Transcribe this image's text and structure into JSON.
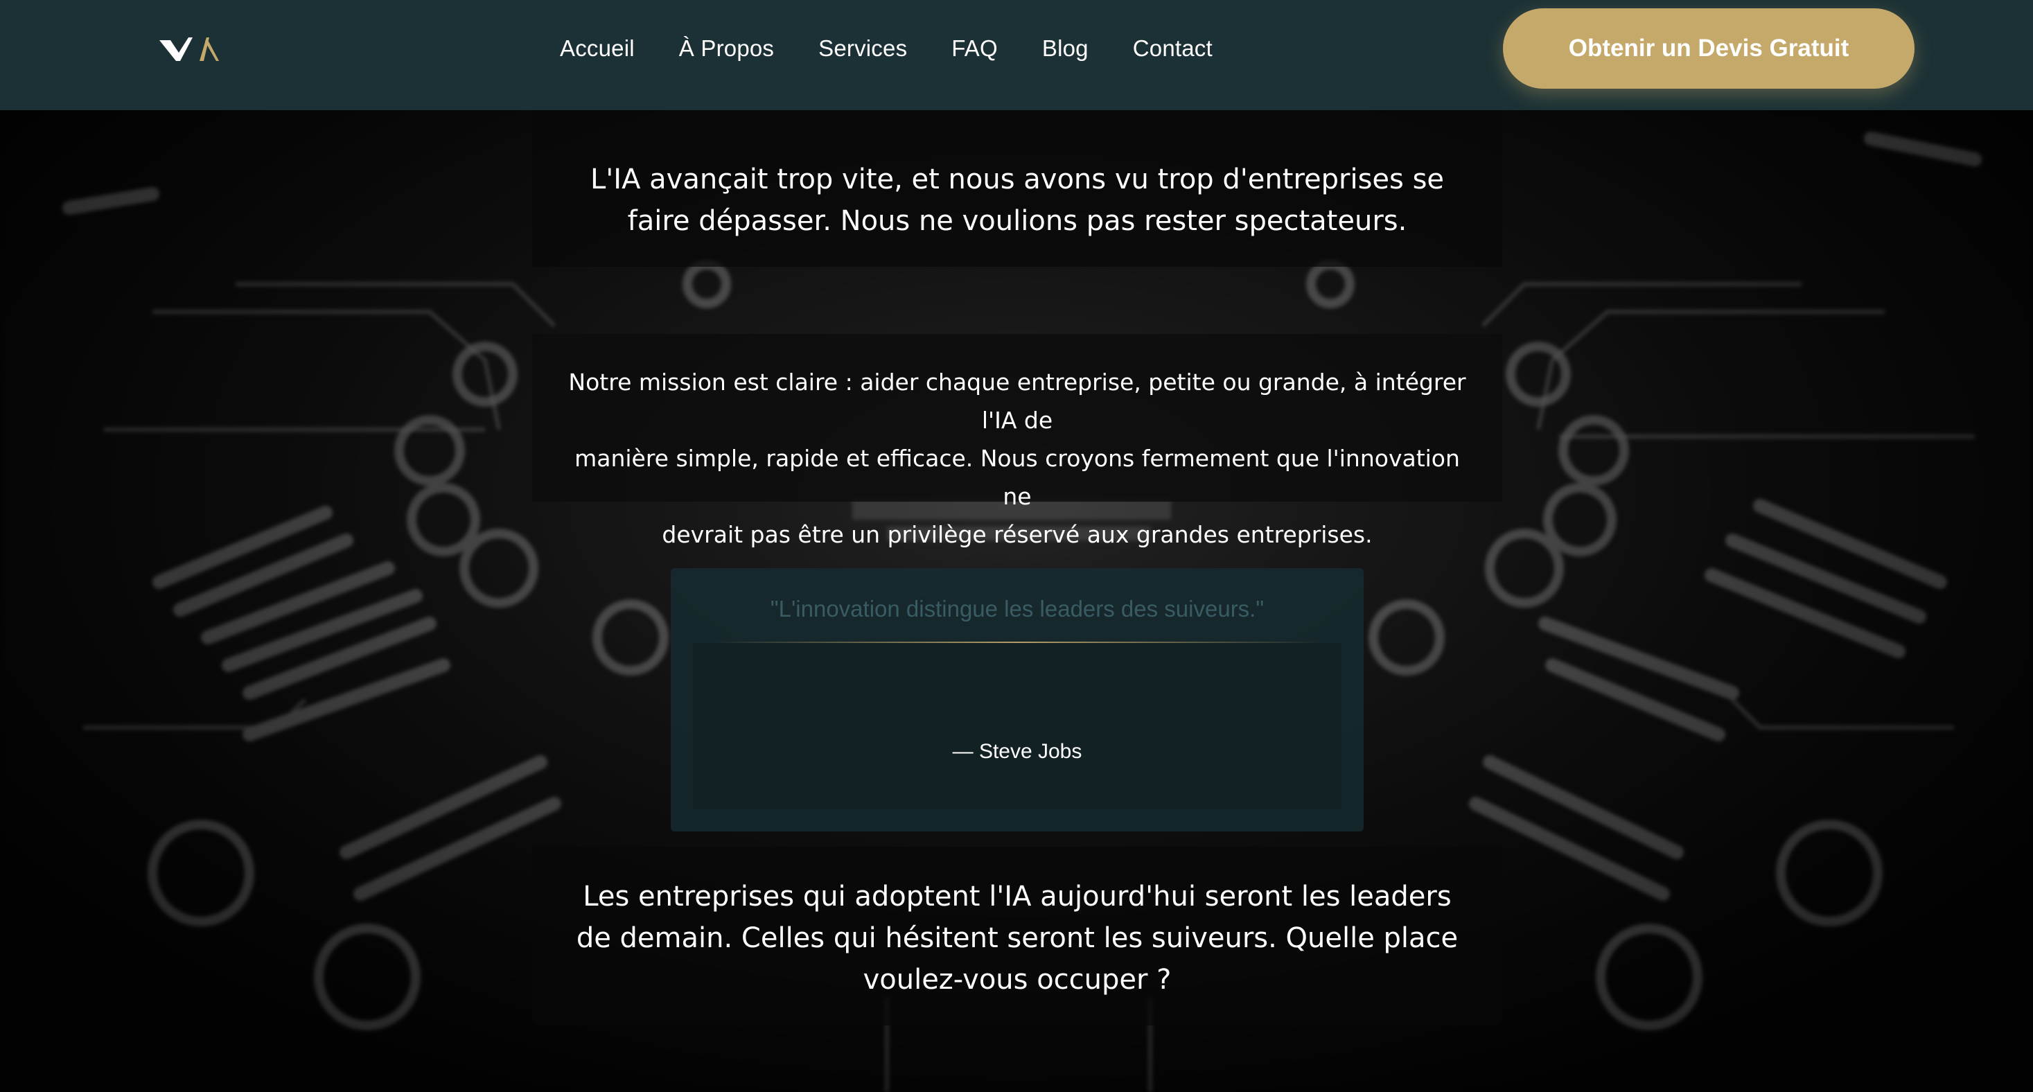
{
  "header": {
    "logo_alt": "VA logo",
    "nav": [
      {
        "label": "Accueil"
      },
      {
        "label": "À Propos"
      },
      {
        "label": "Services"
      },
      {
        "label": "FAQ"
      },
      {
        "label": "Blog"
      },
      {
        "label": "Contact"
      }
    ],
    "cta_label": "Obtenir un Devis Gratuit"
  },
  "intro": {
    "line1": "L'IA avançait trop vite, et nous avons vu trop d'entreprises se",
    "line2": "faire dépasser. Nous ne voulions pas rester spectateurs."
  },
  "mission": {
    "line1": "Notre mission est claire : aider chaque entreprise, petite ou grande, à intégrer l'IA de",
    "line2": "manière simple, rapide et efficace. Nous croyons fermement que l'innovation ne",
    "line3": "devrait pas être un privilège réservé aux grandes entreprises."
  },
  "quote": {
    "text": "\"L'innovation distingue les leaders des suiveurs.\"",
    "author": "— Steve Jobs"
  },
  "closing": {
    "line1": "Les entreprises qui adoptent l'IA aujourd'hui seront les leaders",
    "line2": "de demain. Celles qui hésitent seront les suiveurs. Quelle place",
    "line3": "voulez-vous occuper ?"
  },
  "colors": {
    "header_bg": "#1c3135",
    "accent_gold": "#c4a96b",
    "quote_bg": "#122224"
  }
}
